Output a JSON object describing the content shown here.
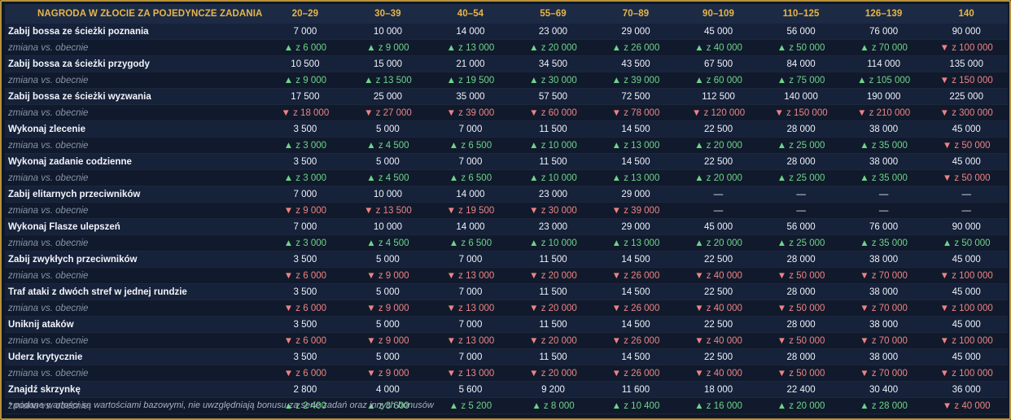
{
  "table": {
    "header": [
      "NAGRODA W ZŁOCIE ZA POJEDYNCZE ZADANIA",
      "20–29",
      "30–39",
      "40–54",
      "55–69",
      "70–89",
      "90–109",
      "110–125",
      "126–139",
      "140"
    ],
    "change_label": "zmiana vs. obecnie",
    "rows": [
      {
        "label": "Zabij bossa ze ścieżki poznania",
        "values": [
          "7 000",
          "10 000",
          "14 000",
          "23 000",
          "29 000",
          "45 000",
          "56 000",
          "76 000",
          "90 000"
        ],
        "changes": [
          {
            "dir": "up",
            "text": "▲ z 6 000"
          },
          {
            "dir": "up",
            "text": "▲ z 9 000"
          },
          {
            "dir": "up",
            "text": "▲ z 13 000"
          },
          {
            "dir": "up",
            "text": "▲ z 20 000"
          },
          {
            "dir": "up",
            "text": "▲ z 26 000"
          },
          {
            "dir": "up",
            "text": "▲ z 40 000"
          },
          {
            "dir": "up",
            "text": "▲ z 50 000"
          },
          {
            "dir": "up",
            "text": "▲ z 70 000"
          },
          {
            "dir": "down",
            "text": "▼ z 100 000"
          }
        ]
      },
      {
        "label": "Zabij bossa za ścieżki przygody",
        "values": [
          "10 500",
          "15 000",
          "21 000",
          "34 500",
          "43 500",
          "67 500",
          "84 000",
          "114 000",
          "135 000"
        ],
        "changes": [
          {
            "dir": "up",
            "text": "▲ z 9 000"
          },
          {
            "dir": "up",
            "text": "▲ z 13 500"
          },
          {
            "dir": "up",
            "text": "▲ z 19 500"
          },
          {
            "dir": "up",
            "text": "▲ z 30 000"
          },
          {
            "dir": "up",
            "text": "▲ z 39 000"
          },
          {
            "dir": "up",
            "text": "▲ z 60 000"
          },
          {
            "dir": "up",
            "text": "▲ z 75 000"
          },
          {
            "dir": "up",
            "text": "▲ z 105 000"
          },
          {
            "dir": "down",
            "text": "▼ z 150 000"
          }
        ]
      },
      {
        "label": "Zabij bossa ze ścieżki wyzwania",
        "values": [
          "17 500",
          "25 000",
          "35 000",
          "57 500",
          "72 500",
          "112 500",
          "140 000",
          "190 000",
          "225 000"
        ],
        "changes": [
          {
            "dir": "down",
            "text": "▼ z 18 000"
          },
          {
            "dir": "down",
            "text": "▼ z 27 000"
          },
          {
            "dir": "down",
            "text": "▼ z 39 000"
          },
          {
            "dir": "down",
            "text": "▼ z 60 000"
          },
          {
            "dir": "down",
            "text": "▼ z 78 000"
          },
          {
            "dir": "down",
            "text": "▼ z 120 000"
          },
          {
            "dir": "down",
            "text": "▼ z 150 000"
          },
          {
            "dir": "down",
            "text": "▼ z 210 000"
          },
          {
            "dir": "down",
            "text": "▼ z 300 000"
          }
        ]
      },
      {
        "label": "Wykonaj zlecenie",
        "values": [
          "3 500",
          "5 000",
          "7 000",
          "11 500",
          "14 500",
          "22 500",
          "28 000",
          "38 000",
          "45 000"
        ],
        "changes": [
          {
            "dir": "up",
            "text": "▲ z 3 000"
          },
          {
            "dir": "up",
            "text": "▲ z 4 500"
          },
          {
            "dir": "up",
            "text": "▲ z 6 500"
          },
          {
            "dir": "up",
            "text": "▲ z 10 000"
          },
          {
            "dir": "up",
            "text": "▲ z 13 000"
          },
          {
            "dir": "up",
            "text": "▲ z 20 000"
          },
          {
            "dir": "up",
            "text": "▲ z 25 000"
          },
          {
            "dir": "up",
            "text": "▲ z 35 000"
          },
          {
            "dir": "down",
            "text": "▼ z 50 000"
          }
        ]
      },
      {
        "label": "Wykonaj zadanie codzienne",
        "values": [
          "3 500",
          "5 000",
          "7 000",
          "11 500",
          "14 500",
          "22 500",
          "28 000",
          "38 000",
          "45 000"
        ],
        "changes": [
          {
            "dir": "up",
            "text": "▲ z 3 000"
          },
          {
            "dir": "up",
            "text": "▲ z 4 500"
          },
          {
            "dir": "up",
            "text": "▲ z 6 500"
          },
          {
            "dir": "up",
            "text": "▲ z 10 000"
          },
          {
            "dir": "up",
            "text": "▲ z 13 000"
          },
          {
            "dir": "up",
            "text": "▲ z 20 000"
          },
          {
            "dir": "up",
            "text": "▲ z 25 000"
          },
          {
            "dir": "up",
            "text": "▲ z 35 000"
          },
          {
            "dir": "down",
            "text": "▼ z 50 000"
          }
        ]
      },
      {
        "label": "Zabij elitarnych przeciwników",
        "values": [
          "7 000",
          "10 000",
          "14 000",
          "23 000",
          "29 000",
          "—",
          "—",
          "—",
          "—"
        ],
        "changes": [
          {
            "dir": "down",
            "text": "▼ z 9 000"
          },
          {
            "dir": "down",
            "text": "▼ z 13 500"
          },
          {
            "dir": "down",
            "text": "▼ z 19 500"
          },
          {
            "dir": "down",
            "text": "▼ z 30 000"
          },
          {
            "dir": "down",
            "text": "▼ z 39 000"
          },
          {
            "dir": "none",
            "text": "—"
          },
          {
            "dir": "none",
            "text": "—"
          },
          {
            "dir": "none",
            "text": "—"
          },
          {
            "dir": "none",
            "text": "—"
          }
        ]
      },
      {
        "label": "Wykonaj Flasze ulepszeń",
        "values": [
          "7 000",
          "10 000",
          "14 000",
          "23 000",
          "29 000",
          "45 000",
          "56 000",
          "76 000",
          "90 000"
        ],
        "changes": [
          {
            "dir": "up",
            "text": "▲ z 3 000"
          },
          {
            "dir": "up",
            "text": "▲ z 4 500"
          },
          {
            "dir": "up",
            "text": "▲ z 6 500"
          },
          {
            "dir": "up",
            "text": "▲ z 10 000"
          },
          {
            "dir": "up",
            "text": "▲ z 13 000"
          },
          {
            "dir": "up",
            "text": "▲ z 20 000"
          },
          {
            "dir": "up",
            "text": "▲ z 25 000"
          },
          {
            "dir": "up",
            "text": "▲ z 35 000"
          },
          {
            "dir": "up",
            "text": "▲ z 50 000"
          }
        ]
      },
      {
        "label": "Zabij zwykłych przeciwników",
        "values": [
          "3 500",
          "5 000",
          "7 000",
          "11 500",
          "14 500",
          "22 500",
          "28 000",
          "38 000",
          "45 000"
        ],
        "changes": [
          {
            "dir": "down",
            "text": "▼ z 6 000"
          },
          {
            "dir": "down",
            "text": "▼ z 9 000"
          },
          {
            "dir": "down",
            "text": "▼ z 13 000"
          },
          {
            "dir": "down",
            "text": "▼ z 20 000"
          },
          {
            "dir": "down",
            "text": "▼ z 26 000"
          },
          {
            "dir": "down",
            "text": "▼ z 40 000"
          },
          {
            "dir": "down",
            "text": "▼ z 50 000"
          },
          {
            "dir": "down",
            "text": "▼ z 70 000"
          },
          {
            "dir": "down",
            "text": "▼ z 100 000"
          }
        ]
      },
      {
        "label": "Traf ataki z dwóch stref w jednej rundzie",
        "values": [
          "3 500",
          "5 000",
          "7 000",
          "11 500",
          "14 500",
          "22 500",
          "28 000",
          "38 000",
          "45 000"
        ],
        "changes": [
          {
            "dir": "down",
            "text": "▼ z 6 000"
          },
          {
            "dir": "down",
            "text": "▼ z 9 000"
          },
          {
            "dir": "down",
            "text": "▼ z 13 000"
          },
          {
            "dir": "down",
            "text": "▼ z 20 000"
          },
          {
            "dir": "down",
            "text": "▼ z 26 000"
          },
          {
            "dir": "down",
            "text": "▼ z 40 000"
          },
          {
            "dir": "down",
            "text": "▼ z 50 000"
          },
          {
            "dir": "down",
            "text": "▼ z 70 000"
          },
          {
            "dir": "down",
            "text": "▼ z 100 000"
          }
        ]
      },
      {
        "label": "Uniknij ataków",
        "values": [
          "3 500",
          "5 000",
          "7 000",
          "11 500",
          "14 500",
          "22 500",
          "28 000",
          "38 000",
          "45 000"
        ],
        "changes": [
          {
            "dir": "down",
            "text": "▼ z 6 000"
          },
          {
            "dir": "down",
            "text": "▼ z 9 000"
          },
          {
            "dir": "down",
            "text": "▼ z 13 000"
          },
          {
            "dir": "down",
            "text": "▼ z 20 000"
          },
          {
            "dir": "down",
            "text": "▼ z 26 000"
          },
          {
            "dir": "down",
            "text": "▼ z 40 000"
          },
          {
            "dir": "down",
            "text": "▼ z 50 000"
          },
          {
            "dir": "down",
            "text": "▼ z 70 000"
          },
          {
            "dir": "down",
            "text": "▼ z 100 000"
          }
        ]
      },
      {
        "label": "Uderz krytycznie",
        "values": [
          "3 500",
          "5 000",
          "7 000",
          "11 500",
          "14 500",
          "22 500",
          "28 000",
          "38 000",
          "45 000"
        ],
        "changes": [
          {
            "dir": "down",
            "text": "▼ z 6 000"
          },
          {
            "dir": "down",
            "text": "▼ z 9 000"
          },
          {
            "dir": "down",
            "text": "▼ z 13 000"
          },
          {
            "dir": "down",
            "text": "▼ z 20 000"
          },
          {
            "dir": "down",
            "text": "▼ z 26 000"
          },
          {
            "dir": "down",
            "text": "▼ z 40 000"
          },
          {
            "dir": "down",
            "text": "▼ z 50 000"
          },
          {
            "dir": "down",
            "text": "▼ z 70 000"
          },
          {
            "dir": "down",
            "text": "▼ z 100 000"
          }
        ]
      },
      {
        "label": "Znajdź skrzynkę",
        "values": [
          "2 800",
          "4 000",
          "5 600",
          "9 200",
          "11 600",
          "18 000",
          "22 400",
          "30 400",
          "36 000"
        ],
        "changes": [
          {
            "dir": "up",
            "text": "▲ z 2 400"
          },
          {
            "dir": "up",
            "text": "▲ z 3 600"
          },
          {
            "dir": "up",
            "text": "▲ z 5 200"
          },
          {
            "dir": "up",
            "text": "▲ z 8 000"
          },
          {
            "dir": "up",
            "text": "▲ z 10 400"
          },
          {
            "dir": "up",
            "text": "▲ z 16 000"
          },
          {
            "dir": "up",
            "text": "▲ z 20 000"
          },
          {
            "dir": "up",
            "text": "▲ z 28 000"
          },
          {
            "dir": "down",
            "text": "▼ z 40 000"
          }
        ]
      }
    ]
  },
  "footnote": "* podane wartości są wartościami bazowymi, nie uwzględniają bonusu za serie zadań oraz innych bonusów",
  "colors": {
    "header_text": "#e7b64a",
    "up": "#6fd48a",
    "down": "#ef8383",
    "border": "#b8923a"
  }
}
